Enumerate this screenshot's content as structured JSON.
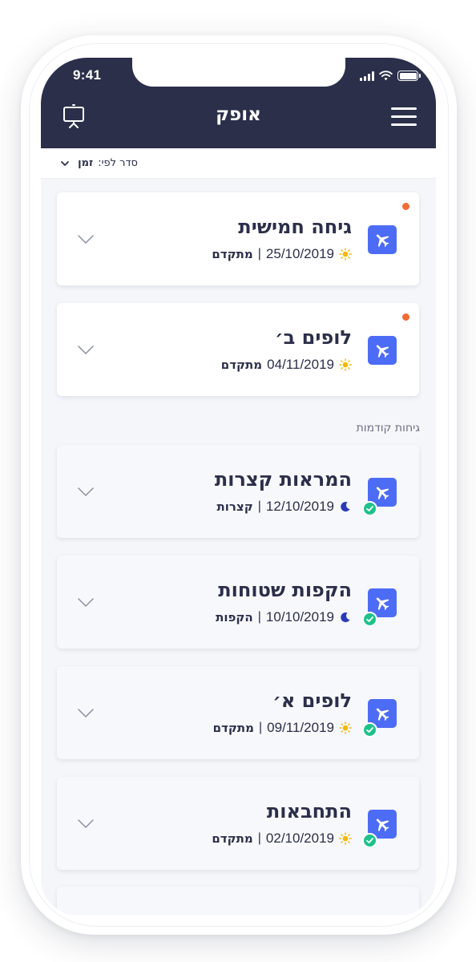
{
  "status_bar": {
    "time": "9:41"
  },
  "header": {
    "title": "אופק"
  },
  "sort": {
    "label": "סדר לפי:",
    "value": "זמן"
  },
  "colors": {
    "header_bg": "#2b2f4a",
    "accent": "#4d6cf5",
    "new_dot": "#f26b35",
    "done": "#1ec28b"
  },
  "upcoming": [
    {
      "title": "גיחה חמישית",
      "date": "25/10/2019",
      "separator": "|",
      "level": "מתקדם",
      "time_icon": "sun-icon",
      "is_new": true,
      "completed": false
    },
    {
      "title": "לופים ב׳",
      "date": "04/11/2019",
      "separator": "",
      "level": "מתקדם",
      "time_icon": "sun-icon",
      "is_new": true,
      "completed": false
    }
  ],
  "previous": {
    "header": "גיחות קודמות",
    "items": [
      {
        "title": "המראות קצרות",
        "date": "12/10/2019",
        "separator": "|",
        "level": "קצרות",
        "time_icon": "moon-icon",
        "is_new": false,
        "completed": true
      },
      {
        "title": "הקפות שטוחות",
        "date": "10/10/2019",
        "separator": "|",
        "level": "הקפות",
        "time_icon": "moon-icon",
        "is_new": false,
        "completed": true
      },
      {
        "title": "לופים א׳",
        "date": "09/11/2019",
        "separator": "|",
        "level": "מתקדם",
        "time_icon": "sun-icon",
        "is_new": false,
        "completed": true
      },
      {
        "title": "התחבאות",
        "date": "02/10/2019",
        "separator": "|",
        "level": "מתקדם",
        "time_icon": "sun-icon",
        "is_new": false,
        "completed": true
      }
    ]
  }
}
